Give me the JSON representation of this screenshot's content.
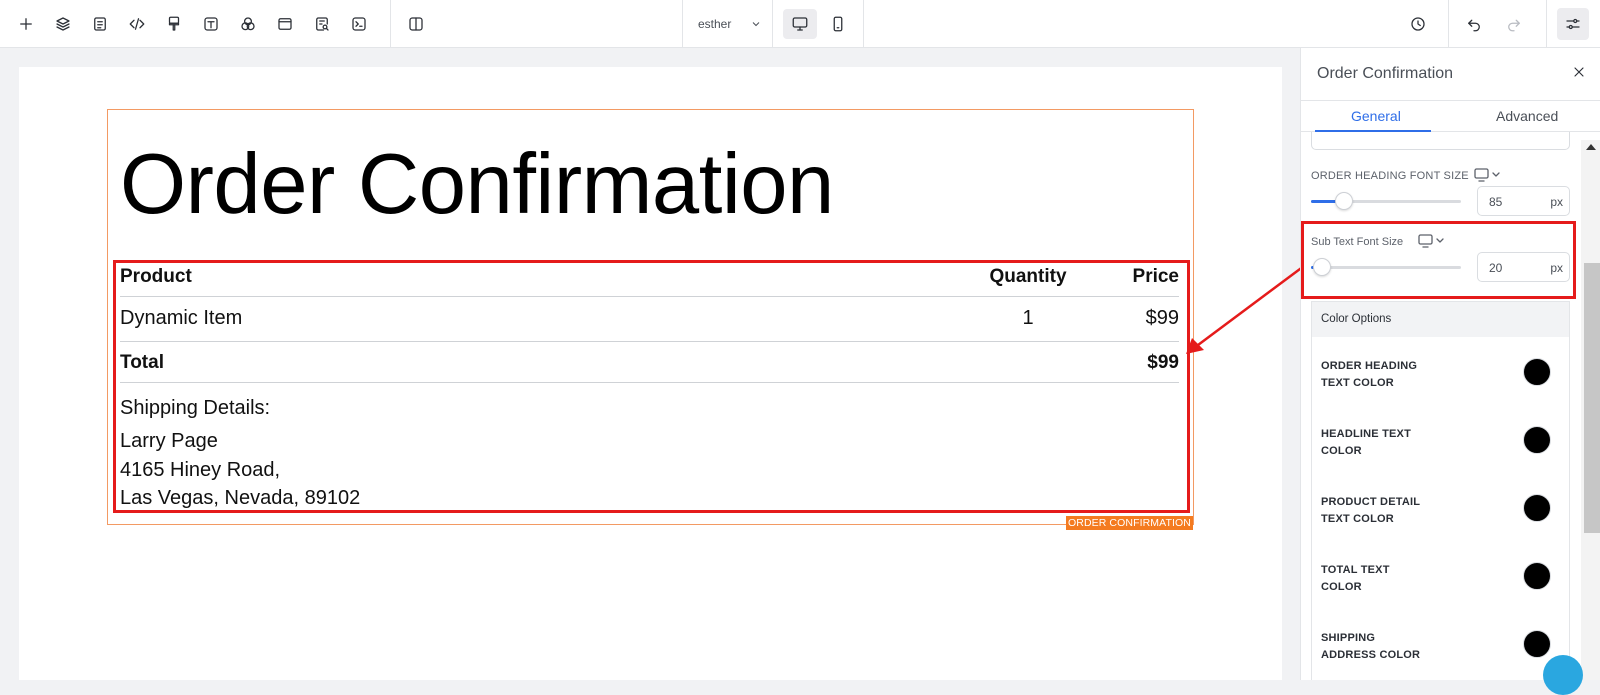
{
  "toolbar": {
    "user_select": "esther",
    "icons": [
      "plus-icon",
      "layers-icon",
      "document-icon",
      "code-icon",
      "brush-icon",
      "text-icon",
      "color-circles-icon",
      "layout-icon",
      "search-doc-icon",
      "terminal-icon",
      "split-view-icon",
      "history-icon",
      "undo-icon",
      "redo-icon",
      "settings-sliders-icon"
    ],
    "devices": [
      "desktop-icon",
      "mobile-icon"
    ]
  },
  "canvas": {
    "heading": "Order Confirmation",
    "block_tag": "ORDER CONFIRMATION",
    "table": {
      "headers": {
        "product": "Product",
        "quantity": "Quantity",
        "price": "Price"
      },
      "item": {
        "product": "Dynamic Item",
        "quantity": "1",
        "price": "$99"
      },
      "total": {
        "label": "Total",
        "price": "$99"
      }
    },
    "shipping": {
      "label": "Shipping Details:",
      "lines": [
        "Larry Page",
        "4165 Hiney Road,",
        "Las Vegas, Nevada, 89102"
      ]
    }
  },
  "panel": {
    "title": "Order Confirmation",
    "tabs": [
      "General",
      "Advanced"
    ],
    "active_tab": "General",
    "order_heading_font_size": {
      "label": "ORDER HEADING FONT SIZE",
      "value": "85",
      "unit": "px",
      "slider_fraction": 0.2
    },
    "sub_text_font_size": {
      "label": "Sub Text Font Size",
      "value": "20",
      "unit": "px",
      "slider_fraction": 0.05
    },
    "color_options": {
      "title": "Color Options",
      "rows": [
        {
          "line1": "ORDER HEADING",
          "line2": "TEXT COLOR",
          "color": "#000000"
        },
        {
          "line1": "HEADLINE TEXT",
          "line2": "COLOR",
          "color": "#000000"
        },
        {
          "line1": "PRODUCT DETAIL",
          "line2": "TEXT COLOR",
          "color": "#000000"
        },
        {
          "line1": "TOTAL TEXT",
          "line2": "COLOR",
          "color": "#000000"
        },
        {
          "line1": "SHIPPING",
          "line2": "ADDRESS COLOR",
          "color": "#000000"
        }
      ]
    }
  },
  "colors": {
    "accent": "#2f6ee8",
    "highlight": "#e51b1b",
    "block_border": "#f39a63",
    "tag_bg": "#f47b20"
  }
}
